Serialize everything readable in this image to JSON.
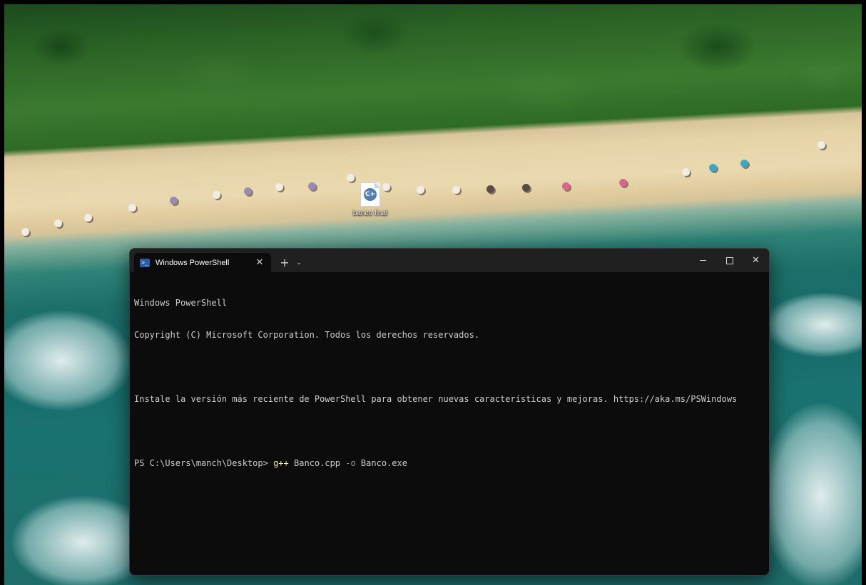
{
  "desktop": {
    "icon": {
      "label": "banco final",
      "glyph": "C+",
      "icon_name": "cpp-file-icon"
    }
  },
  "terminal": {
    "tab": {
      "title": "Windows PowerShell",
      "icon": "powershell-icon",
      "close_glyph": "✕"
    },
    "new_tab_glyph": "+",
    "dropdown_glyph": "⌄",
    "controls": {
      "close_glyph": "✕"
    },
    "lines": [
      "Windows PowerShell",
      "Copyright (C) Microsoft Corporation. Todos los derechos reservados.",
      "",
      "Instale la versión más reciente de PowerShell para obtener nuevas características y mejoras. https://aka.ms/PSWindows",
      ""
    ],
    "prompt": {
      "path": "PS C:\\Users\\manch\\Desktop> ",
      "exe": "g++",
      "args": " Banco.cpp ",
      "param": "-o",
      "tail": " Banco.exe"
    },
    "colors": {
      "background": "#0c0c0c",
      "text": "#cccccc",
      "command": "#f9f1a5",
      "param": "#9a9a9a"
    }
  }
}
